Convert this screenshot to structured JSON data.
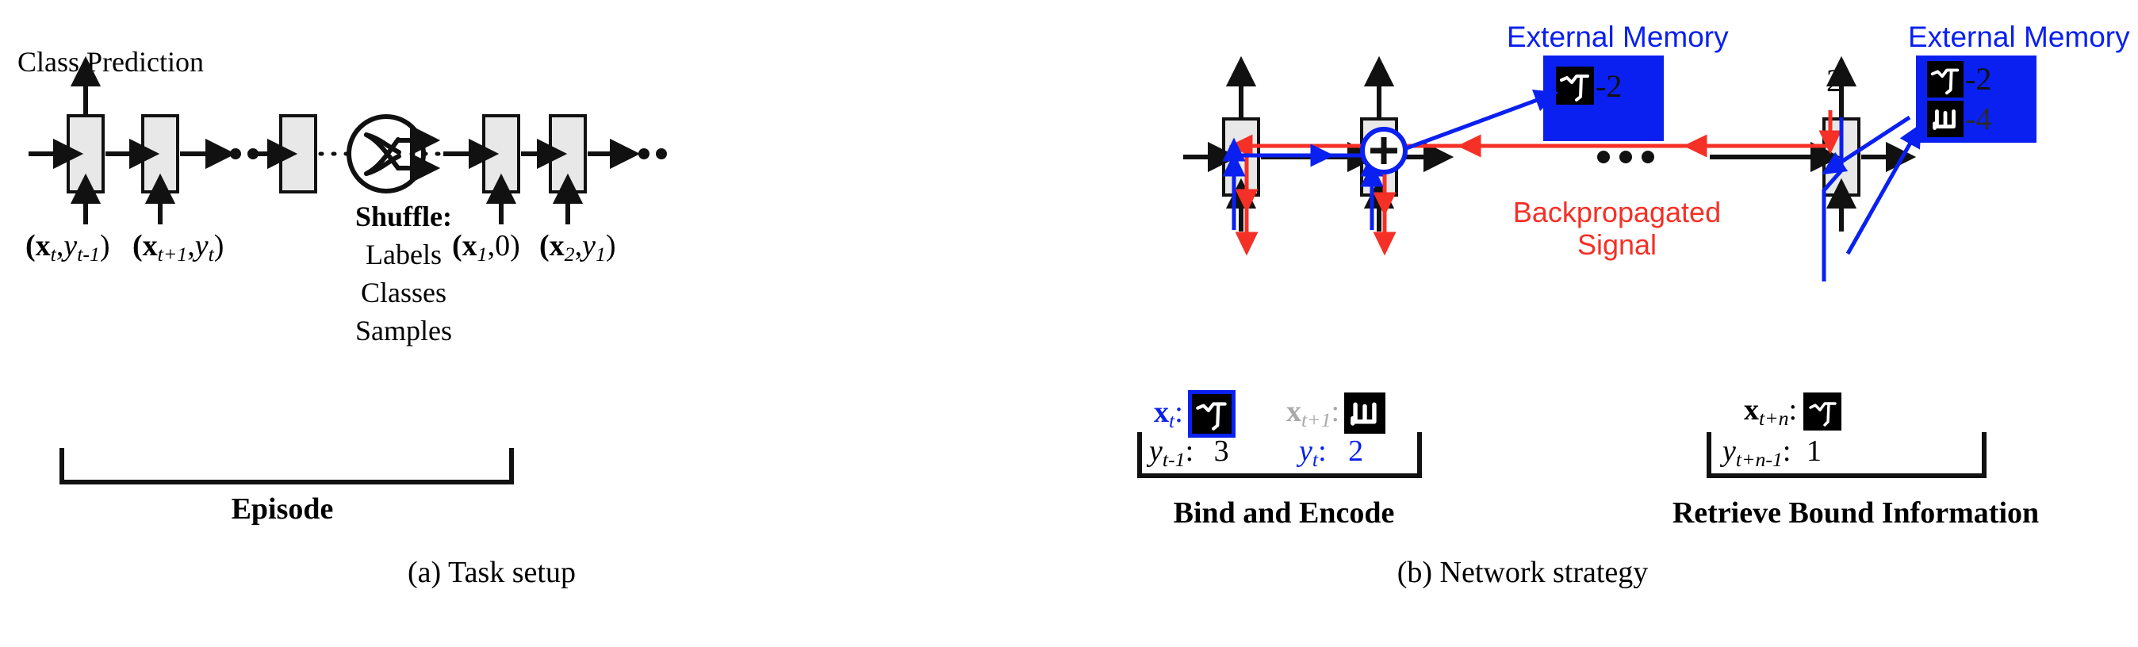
{
  "figure": {
    "panels": [
      {
        "id": "a",
        "caption": "(a) Task setup"
      },
      {
        "id": "b",
        "caption": "(b) Network strategy"
      }
    ]
  },
  "panel_a": {
    "class_prediction_label": "Class Prediction",
    "episode_label": "Episode",
    "shuffle": {
      "title": "Shuffle:",
      "items": [
        "Labels",
        "Classes",
        "Samples"
      ],
      "icon": "shuffle-icon"
    },
    "inputs_left": [
      {
        "math": "(x_t, y_{t-1})",
        "x_sym": "x",
        "x_sub": "t",
        "y_sym": "y",
        "y_sub": "t-1"
      },
      {
        "math": "(x_{t+1}, y_t)",
        "x_sym": "x",
        "x_sub": "t+1",
        "y_sym": "y",
        "y_sub": "t"
      }
    ],
    "inputs_right": [
      {
        "math": "(x_1, 0)",
        "x_sym": "x",
        "x_sub": "1",
        "y_sym": "0",
        "y_sub": ""
      },
      {
        "math": "(x_2, y_1)",
        "x_sym": "x",
        "x_sub": "2",
        "y_sym": "y",
        "y_sub": "1"
      }
    ],
    "ellipsis": "• • •"
  },
  "panel_b": {
    "external_memory_title": "External Memory",
    "backprop_line1": "Backpropagated",
    "backprop_line2": "Signal",
    "group_left_label": "Bind and Encode",
    "group_right_label": "Retrieve Bound Information",
    "output_value_right": "2",
    "memory_left": {
      "title": "External Memory",
      "entries": [
        {
          "glyph": "omniglot-char-A",
          "value": "-2"
        }
      ]
    },
    "memory_right": {
      "title": "External Memory",
      "entries": [
        {
          "glyph": "omniglot-char-A",
          "value": "-2"
        },
        {
          "glyph": "omniglot-char-B",
          "value": "-4"
        }
      ]
    },
    "inputs": [
      {
        "name": "x_t",
        "x_sym": "x",
        "x_sub": "t",
        "color": "#0a20f0",
        "glyph": "omniglot-char-A",
        "label_sym": "y",
        "label_sub": "t-1",
        "label_value": "3",
        "label_color": "#111111",
        "glyph_highlight": true
      },
      {
        "name": "x_t+1",
        "x_sym": "x",
        "x_sub": "t+1",
        "color": "#a9a9a9",
        "glyph": "omniglot-char-B",
        "label_sym": "y",
        "label_sub": "t",
        "label_value": "2",
        "label_color": "#0a20f0",
        "glyph_highlight": false
      },
      {
        "name": "x_t+n",
        "x_sym": "x",
        "x_sub": "t+n",
        "color": "#111111",
        "glyph": "omniglot-char-A",
        "label_sym": "y",
        "label_sub": "t+n-1",
        "label_value": "1",
        "label_color": "#111111",
        "glyph_highlight": false
      }
    ],
    "ellipsis": "• • •",
    "colors": {
      "memory": "#0a20f0",
      "backprop": "#f53027",
      "cell_fill": "#e8e8e8",
      "stroke": "#111111"
    }
  }
}
